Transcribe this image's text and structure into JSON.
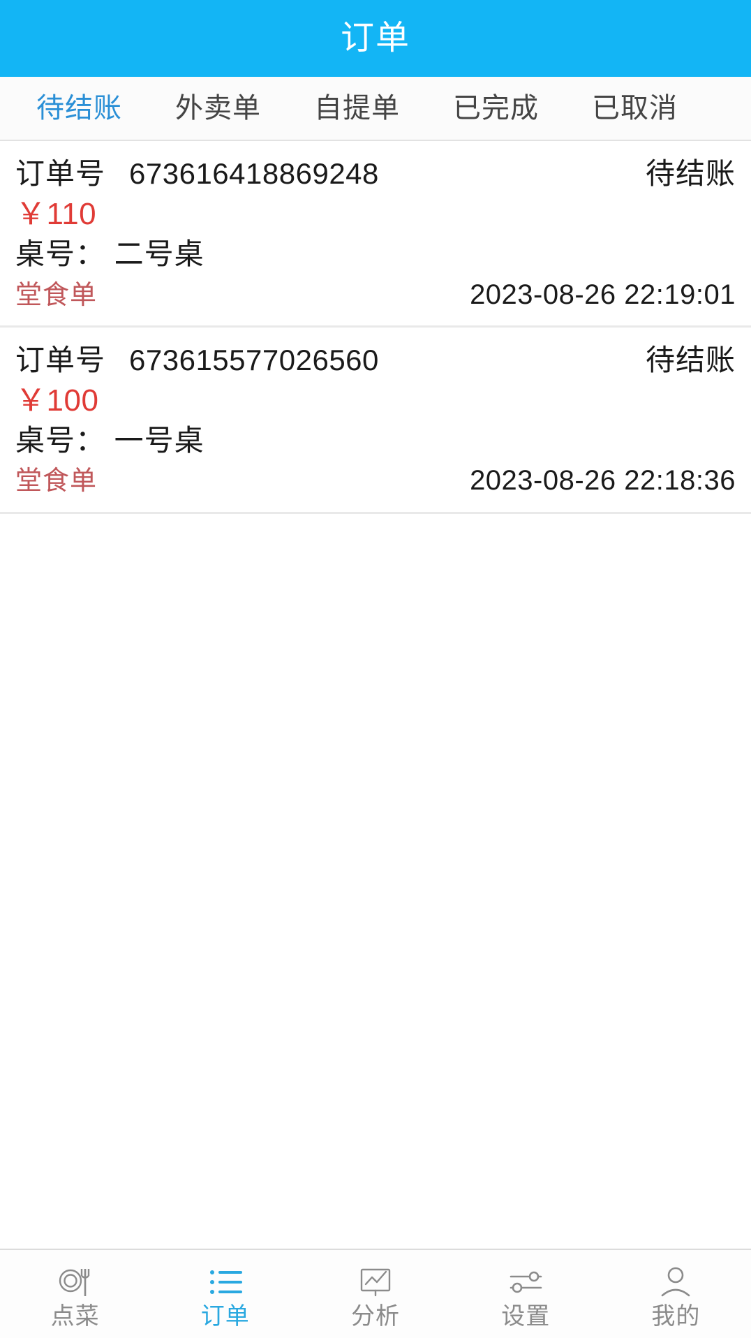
{
  "header": {
    "title": "订单",
    "background_color": "#13b5f5",
    "text_color": "#ffffff"
  },
  "tabs": {
    "active_index": 0,
    "active_color": "#2a8fd6",
    "inactive_color": "#444444",
    "items": [
      {
        "label": "待结账"
      },
      {
        "label": "外卖单"
      },
      {
        "label": "自提单"
      },
      {
        "label": "已完成"
      },
      {
        "label": "已取消"
      }
    ]
  },
  "orders": {
    "label_order_no": "订单号",
    "amount_color": "#e03b36",
    "order_type_color": "#c0575a",
    "items": [
      {
        "order_no": "673616418869248",
        "status": "待结账",
        "amount": "￥110",
        "table_label": "桌号：",
        "table_no": "二号桌",
        "table_line": "桌号： 二号桌",
        "order_type": "堂食单",
        "timestamp": "2023-08-26 22:19:01"
      },
      {
        "order_no": "673615577026560",
        "status": "待结账",
        "amount": "￥100",
        "table_label": "桌号：",
        "table_no": "一号桌",
        "table_line": "桌号： 一号桌",
        "order_type": "堂食单",
        "timestamp": "2023-08-26 22:18:36"
      }
    ]
  },
  "bottom_nav": {
    "active_index": 1,
    "active_color": "#29a8e0",
    "inactive_color": "#8b8b8b",
    "items": [
      {
        "label": "点菜",
        "icon": "plate-fork-icon"
      },
      {
        "label": "订单",
        "icon": "list-icon"
      },
      {
        "label": "分析",
        "icon": "chart-icon"
      },
      {
        "label": "设置",
        "icon": "sliders-icon"
      },
      {
        "label": "我的",
        "icon": "person-icon"
      }
    ]
  }
}
